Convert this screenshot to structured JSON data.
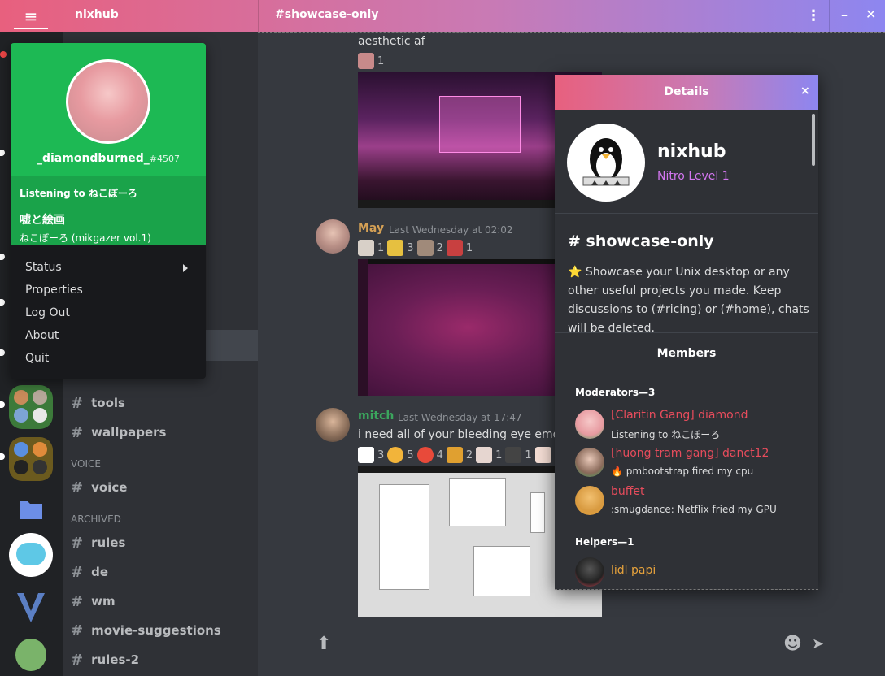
{
  "titlebar": {
    "menu_icon": "hamburger-icon",
    "server_name": "nixhub",
    "channel_name": "#showcase-only",
    "more_icon": "kebab-icon",
    "minimize_icon": "minimize-icon",
    "close_icon": "close-icon",
    "kebab_glyph": "⋮",
    "minimize_glyph": "–",
    "close_glyph": "✕"
  },
  "popup": {
    "username": "_diamondburned_",
    "discriminator": "#4507",
    "activity_header": "Listening to ねこぼーろ",
    "song": "嘘と絵画",
    "artist_album": "ねこぼーろ (mikgazer vol.1)",
    "menu": [
      {
        "label": "Status"
      },
      {
        "label": "Properties"
      },
      {
        "label": "Log Out"
      },
      {
        "label": "About"
      },
      {
        "label": "Quit"
      }
    ]
  },
  "channels": {
    "items": [
      {
        "name": "tools"
      },
      {
        "name": "wallpapers"
      }
    ],
    "voice_category": "VOICE",
    "voice_items": [
      {
        "name": "voice"
      }
    ],
    "archived_category": "ARCHIVED",
    "archived_items": [
      {
        "name": "rules"
      },
      {
        "name": "de"
      },
      {
        "name": "wm"
      },
      {
        "name": "movie-suggestions"
      },
      {
        "name": "rules-2"
      }
    ]
  },
  "messages": [
    {
      "text": "aesthetic af",
      "reactions": [
        {
          "count": "1"
        }
      ]
    },
    {
      "author": "May",
      "author_color": "#d4a055",
      "time": "Last Wednesday at 02:02",
      "reactions": [
        {
          "count": "1"
        },
        {
          "count": "3"
        },
        {
          "count": "2"
        },
        {
          "count": "1"
        }
      ]
    },
    {
      "author": "mitch",
      "author_color": "#3ba55d",
      "time": "Last Wednesday at 17:47",
      "text": "i need all of your bleeding eye emojis",
      "reactions": [
        {
          "count": "3"
        },
        {
          "count": "5"
        },
        {
          "count": "4"
        },
        {
          "count": "2"
        },
        {
          "count": "1"
        },
        {
          "count": "1"
        }
      ]
    }
  ],
  "composer": {
    "upload_icon": "upload-icon",
    "emoji_icon": "emoji-icon",
    "send_icon": "send-icon"
  },
  "details": {
    "title": "Details",
    "close_glyph": "×",
    "server_name": "nixhub",
    "nitro": "Nitro Level 1",
    "channel": "showcase-only",
    "description": "⭐ Showcase your Unix desktop or any other useful projects you made. Keep discussions to (#ricing) or (#home), chats will be deleted.",
    "members_header": "Members",
    "moderators_header": "Moderators—3",
    "moderators": [
      {
        "name": "[Claritin Gang] diamond",
        "status": "Listening to ねこぼーろ",
        "color": "#e74c5c"
      },
      {
        "name": "[huong tram gang] danct12",
        "status": "🔥 pmbootstrap fired my cpu",
        "color": "#e74c5c"
      },
      {
        "name": "buffet",
        "status": ":smugdance: Netflix fried my GPU",
        "color": "#e74c5c"
      }
    ],
    "helpers_header": "Helpers—1",
    "helpers": [
      {
        "name": "lidl papi",
        "color": "#e6a23c"
      }
    ]
  }
}
